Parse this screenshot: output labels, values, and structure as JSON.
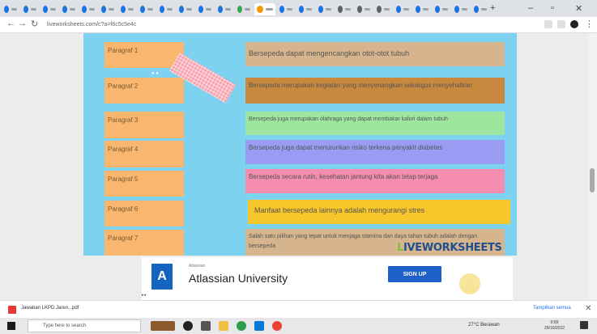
{
  "browser": {
    "url": "liveworksheets.com/c?a=f6c5c5e4c",
    "window_controls": {
      "minimize": "–",
      "maximize": "▫",
      "close": "✕"
    }
  },
  "worksheet": {
    "rows": [
      {
        "label": "Paragraf 1",
        "answer": "Bersepeda dapat mengencangkan otot-otot tubuh",
        "color": "#d6b48d"
      },
      {
        "label": "Paragraf 2",
        "answer": "Bersepeda merupakan kegiatan yang menyenangkan sekaligus menyehatkan",
        "color": "#c8893f"
      },
      {
        "label": "Paragraf 3",
        "answer": "Bersepeda juga merupakan olahraga yang dapat membakar kalori dalam tubuh",
        "color": "#9de6a0"
      },
      {
        "label": "Paragraf 4",
        "answer": "Bersepeda juga dapat menurunkan risiko terkena penyakit diabetes",
        "color": "#9a9cf3"
      },
      {
        "label": "Paragraf 5",
        "answer": "Bersepeda secara rutin, kesehatan jantung kita akan tetap terjaga",
        "color": "#f48db0"
      },
      {
        "label": "Paragraf 6",
        "answer": "Manfaat bersepeda lainnya adalah mengurangi stres",
        "color": "#f7c62a"
      },
      {
        "label": "Paragraf 7",
        "answer": "Salah satu pilihan yang tepat untuk menjaga stamina dan daya tahan tubuh adalah dengan bersepeda",
        "color": "#d6b48d"
      }
    ],
    "brand": {
      "prefix": "L",
      "rest": "IVEWORKSHEETS"
    }
  },
  "ad": {
    "sponsor": "Atlassian",
    "title": "Atlassian University",
    "cta": "SIGN UP",
    "logo_glyph": "A"
  },
  "download": {
    "file_name": "Jawaban LKPD Jaren...pdf",
    "show_all": "Tampilkan semua"
  },
  "taskbar": {
    "search_placeholder": "Type here to search",
    "weather": "27°C Berawan",
    "time": "0:00",
    "date": "29/10/2022"
  }
}
